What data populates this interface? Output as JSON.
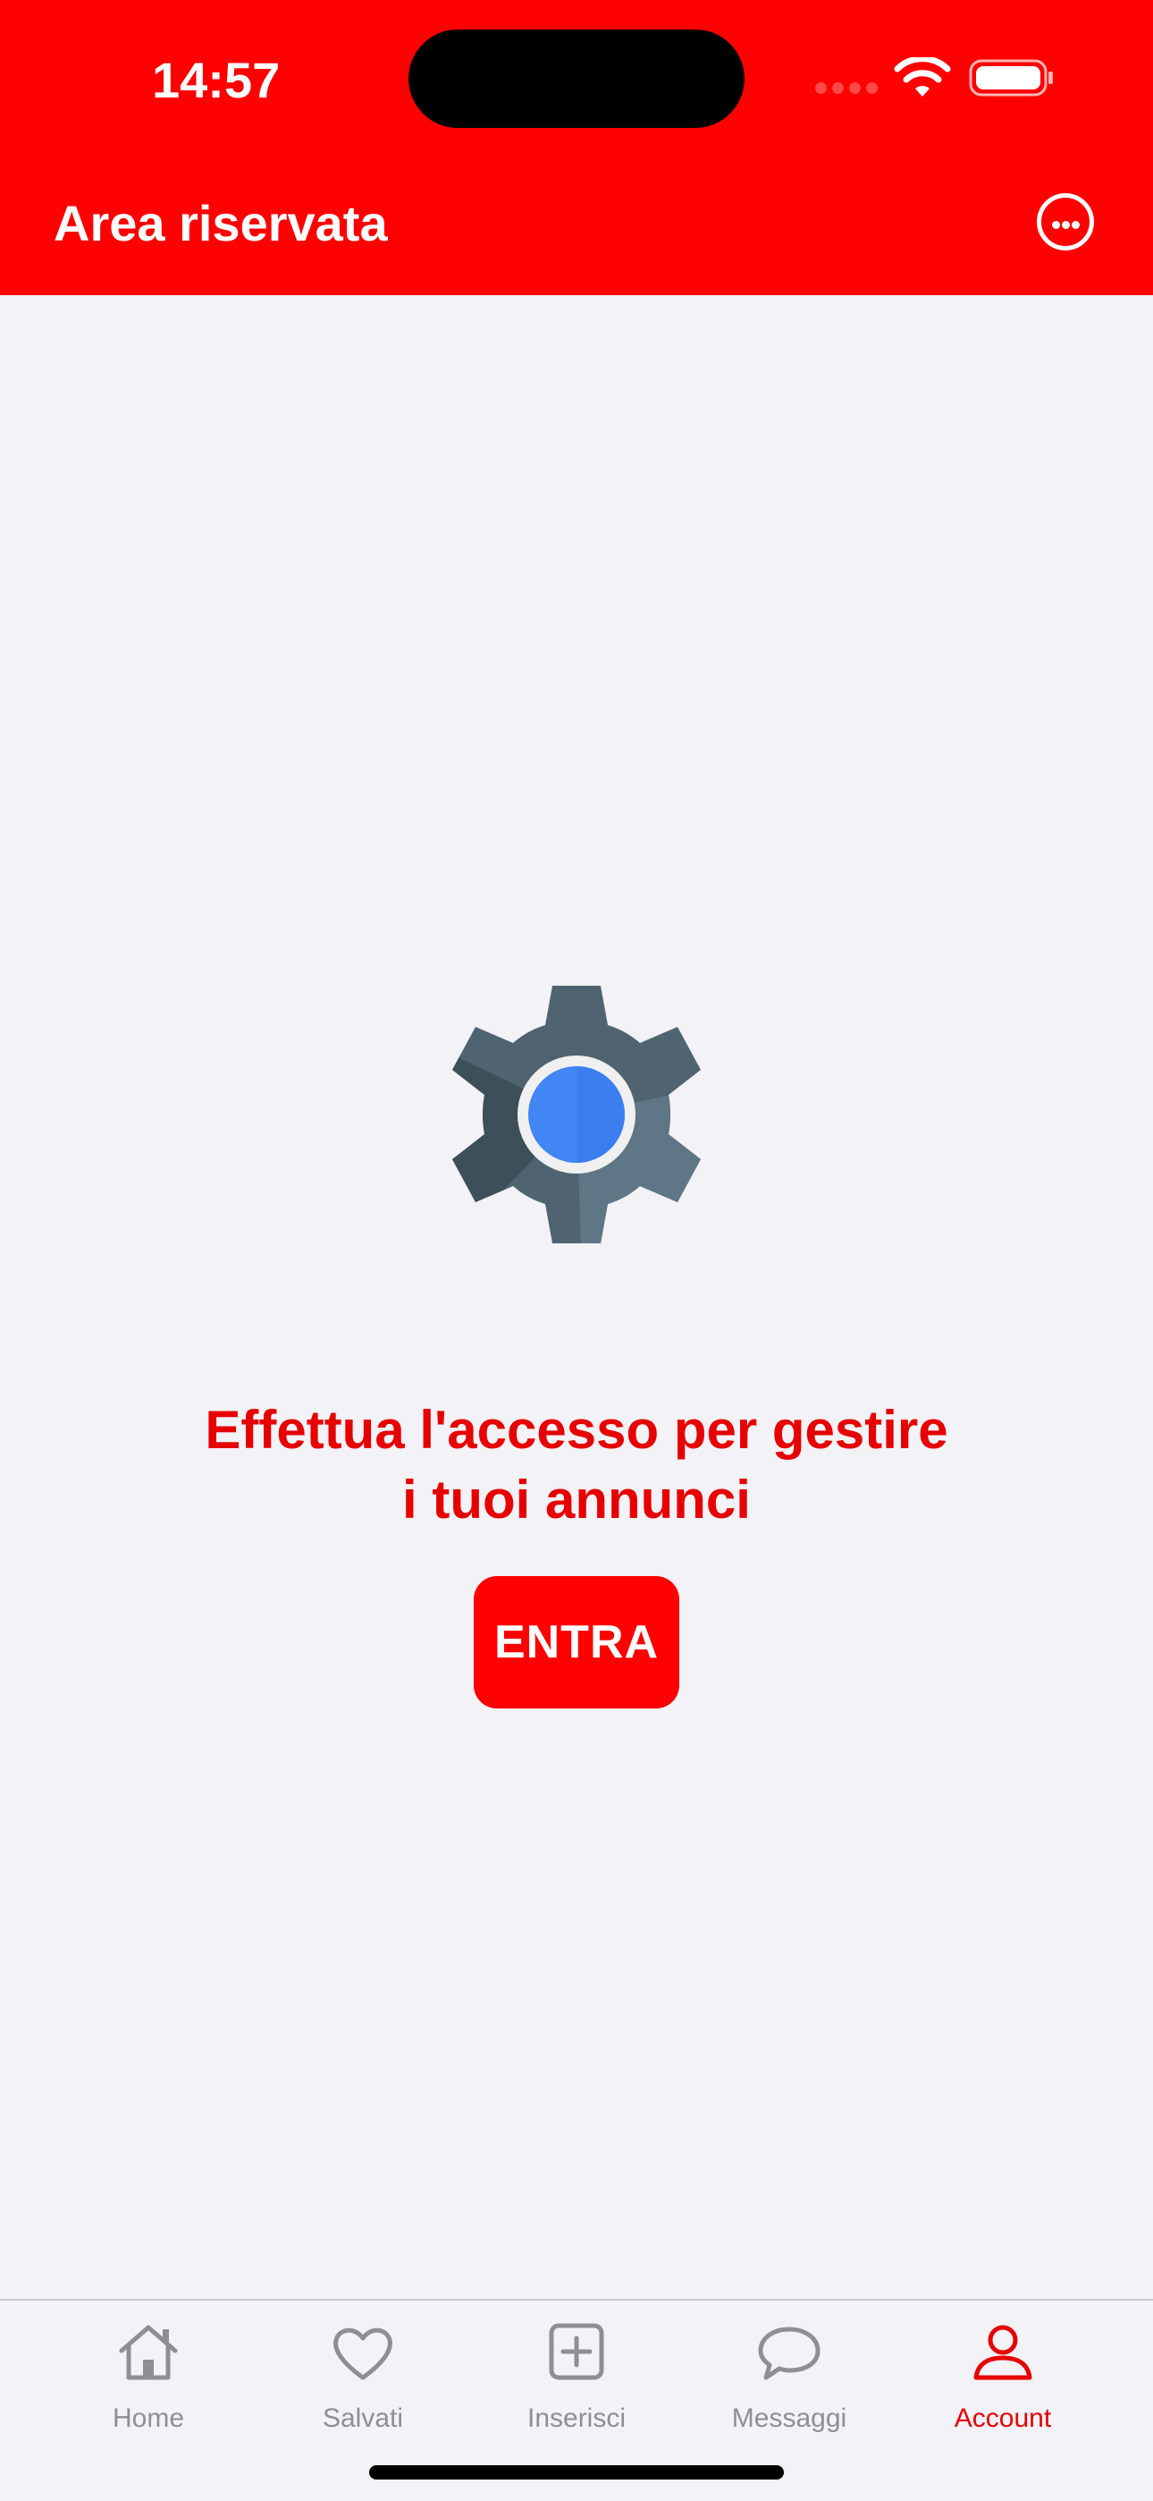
{
  "status_bar": {
    "time": "14:57"
  },
  "header": {
    "title": "Area riservata"
  },
  "main": {
    "message_line1": "Effettua l'accesso per gestire",
    "message_line2": "i tuoi annunci",
    "enter_label": "ENTRA"
  },
  "tabbar": {
    "items": [
      {
        "label": "Home",
        "icon": "home-icon"
      },
      {
        "label": "Salvati",
        "icon": "heart-icon"
      },
      {
        "label": "Inserisci",
        "icon": "plus-square-icon"
      },
      {
        "label": "Messaggi",
        "icon": "chat-bubble-icon"
      },
      {
        "label": "Account",
        "icon": "person-icon",
        "active": true
      }
    ]
  },
  "colors": {
    "brand_red": "#ff0000",
    "message_red": "#e60000",
    "background": "#f2f2f7",
    "inactive_tab": "#8e8e93"
  }
}
